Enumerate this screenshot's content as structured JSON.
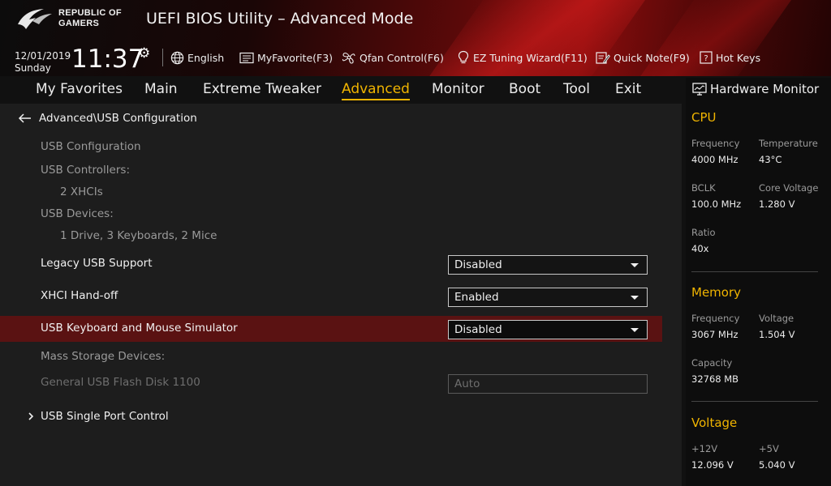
{
  "header": {
    "brand_line1": "REPUBLIC OF",
    "brand_line2": "GAMERS",
    "title": "UEFI BIOS Utility – Advanced Mode",
    "date": "12/01/2019",
    "weekday": "Sunday",
    "time": "11:37",
    "toolbar": {
      "language": "English",
      "myfavorite": "MyFavorite(F3)",
      "qfan": "Qfan Control(F6)",
      "ez_tuning": "EZ Tuning Wizard(F11)",
      "quick_note": "Quick Note(F9)",
      "hot_keys": "Hot Keys"
    }
  },
  "nav": {
    "tabs": [
      {
        "label": "My Favorites"
      },
      {
        "label": "Main"
      },
      {
        "label": "Extreme Tweaker"
      },
      {
        "label": "Advanced"
      },
      {
        "label": "Monitor"
      },
      {
        "label": "Boot"
      },
      {
        "label": "Tool"
      },
      {
        "label": "Exit"
      }
    ],
    "active": "Advanced",
    "accent_color": "#f0b400"
  },
  "main": {
    "breadcrumb": "Advanced\\USB Configuration",
    "usb_configuration": "USB Configuration",
    "usb_controllers_label": "USB Controllers:",
    "usb_controllers_value": "2 XHCIs",
    "usb_devices_label": "USB Devices:",
    "usb_devices_value": "1 Drive, 3 Keyboards, 2 Mice",
    "settings": {
      "legacy_usb": {
        "label": "Legacy USB Support",
        "value": "Disabled"
      },
      "xhci": {
        "label": "XHCI Hand-off",
        "value": "Enabled"
      },
      "kbm_sim": {
        "label": "USB Keyboard and Mouse Simulator",
        "value": "Disabled"
      }
    },
    "mass_storage_label": "Mass Storage Devices:",
    "flash_disk": {
      "label": "General USB Flash Disk 1100",
      "value": "Auto"
    },
    "submenu": "USB Single Port Control",
    "highlight_color": "#5a1212"
  },
  "hw_monitor": {
    "title": "Hardware Monitor",
    "cpu": {
      "heading": "CPU",
      "frequency_label": "Frequency",
      "frequency": "4000 MHz",
      "temperature_label": "Temperature",
      "temperature": "43°C",
      "bclk_label": "BCLK",
      "bclk": "100.0 MHz",
      "core_voltage_label": "Core Voltage",
      "core_voltage": "1.280 V",
      "ratio_label": "Ratio",
      "ratio": "40x"
    },
    "memory": {
      "heading": "Memory",
      "frequency_label": "Frequency",
      "frequency": "3067 MHz",
      "voltage_label": "Voltage",
      "voltage": "1.504 V",
      "capacity_label": "Capacity",
      "capacity": "32768 MB"
    },
    "voltage": {
      "heading": "Voltage",
      "v12_label": "+12V",
      "v12": "12.096 V",
      "v5_label": "+5V",
      "v5": "5.040 V"
    }
  }
}
